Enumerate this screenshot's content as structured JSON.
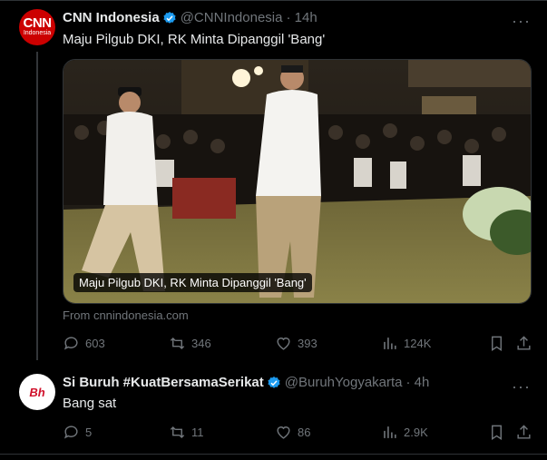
{
  "tweet1": {
    "name": "CNN Indonesia",
    "handle": "@CNNIndonesia",
    "time": "· 14h",
    "text": "Maju Pilgub DKI, RK Minta Dipanggil 'Bang'",
    "avatar_text": "CNN",
    "avatar_sub": "Indonesia",
    "media_caption": "Maju Pilgub DKI, RK Minta Dipanggil 'Bang'",
    "source": "From cnnindonesia.com",
    "stats": {
      "replies": "603",
      "reposts": "346",
      "likes": "393",
      "views": "124K"
    }
  },
  "tweet2": {
    "name": "Si Buruh #KuatBersamaSerikat",
    "handle": "@BuruhYogyakarta",
    "time": "· 4h",
    "text": "Bang sat",
    "avatar_text": "Bh",
    "stats": {
      "replies": "5",
      "reposts": "11",
      "likes": "86",
      "views": "2.9K"
    }
  },
  "icons": {
    "verified": "verified-badge-icon",
    "reply": "reply-icon",
    "repost": "repost-icon",
    "like": "heart-icon",
    "views": "views-icon",
    "bookmark": "bookmark-icon",
    "share": "share-icon",
    "more": "more-icon"
  },
  "colors": {
    "background": "#000000",
    "accent": "#1d9bf0",
    "muted": "#71767b",
    "brand_cnn": "#cc0000"
  }
}
